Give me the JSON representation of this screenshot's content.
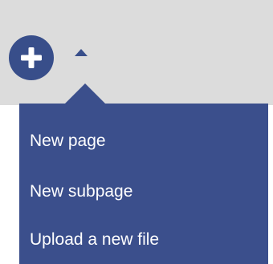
{
  "toolbar": {
    "add_button_icon": "plus-icon",
    "toggle_icon": "caret-up-icon"
  },
  "menu": {
    "items": [
      {
        "label": "New page"
      },
      {
        "label": "New subpage"
      },
      {
        "label": "Upload a new file"
      }
    ]
  },
  "colors": {
    "accent": "#3b4f8c",
    "toolbar_bg": "#dcdcdc",
    "menu_text": "#ffffff"
  }
}
